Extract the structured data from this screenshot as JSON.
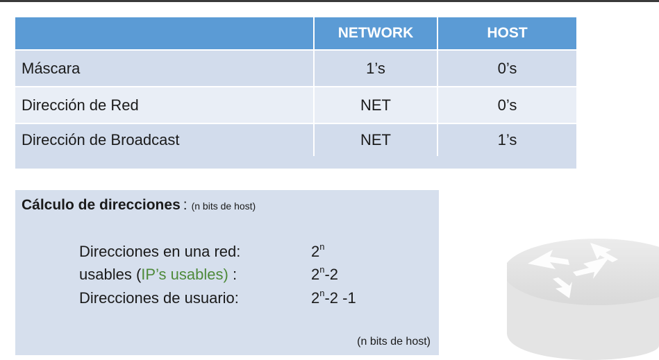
{
  "table": {
    "headers": [
      "",
      "NETWORK",
      "HOST"
    ],
    "rows": [
      {
        "label": "Máscara",
        "network": "1’s",
        "host": "0’s"
      },
      {
        "label": "Dirección de Red",
        "network": "NET",
        "host": "0’s"
      },
      {
        "label": "Dirección de Broadcast",
        "network": "NET",
        "host": "1’s"
      }
    ]
  },
  "calc": {
    "title": "Cálculo de  direcciones",
    "colon": ":",
    "note": "(n bits de  host)",
    "lines": [
      {
        "pre": "Direcciones  en una  red:",
        "base": "2",
        "exp": "n",
        "suffix": ""
      },
      {
        "pre": "usables  (",
        "green": "IP’s usables)",
        "post": " :",
        "base": "2",
        "exp": "n",
        "suffix": "-2"
      },
      {
        "pre": "Direcciones de  usuario:",
        "base": "2",
        "exp": "n",
        "suffix": "-2 -1"
      }
    ],
    "footnote": "(n bits de  host)"
  },
  "colors": {
    "header": "#5b9bd5",
    "row_dark": "#d2dcec",
    "row_light": "#e9eef6",
    "box": "#d6dfed",
    "green": "#4e8a3a"
  },
  "icons": [
    "router-icon"
  ]
}
